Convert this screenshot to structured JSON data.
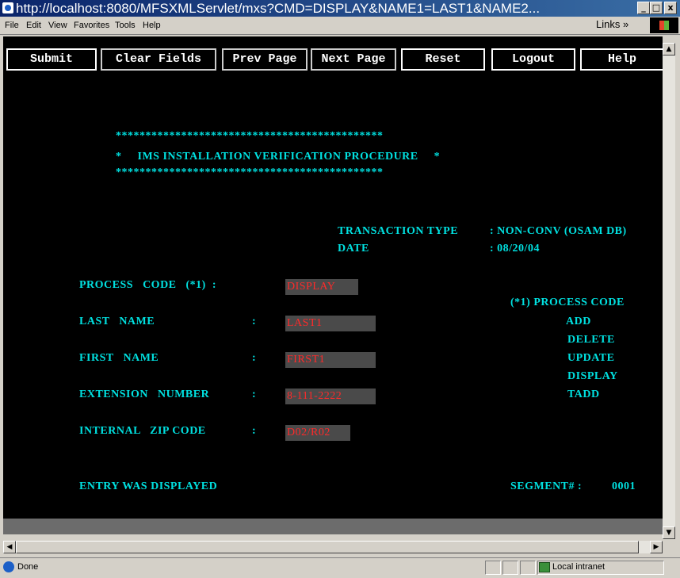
{
  "window": {
    "title": "http://localhost:8080/MFSXMLServlet/mxs?CMD=DISPLAY&NAME1=LAST1&NAME2...",
    "min": "_",
    "max": "□",
    "close": "x"
  },
  "menu": [
    "File",
    "Edit",
    "View",
    "Favorites",
    "Tools",
    "Help"
  ],
  "links_label": "Links »",
  "function_buttons": [
    "Submit",
    "Clear Fields",
    "Prev Page",
    "Next Page",
    "Reset",
    "Logout",
    "Help"
  ],
  "banner": {
    "border_top": "*********************************************",
    "title_line": "*     IMS INSTALLATION VERIFICATION PROCEDURE     *",
    "border_bottom": "*********************************************"
  },
  "transaction": {
    "type_label": "TRANSACTION TYPE",
    "type_value": ": NON-CONV (OSAM DB)",
    "date_label": "DATE",
    "date_value": ": 08/20/04"
  },
  "form": {
    "process_code_label": "PROCESS   CODE   (*1)  :",
    "process_code_value": "DISPLAY",
    "last_name_label": "LAST   NAME",
    "last_name_colon": ":",
    "last_name_value": "LAST1",
    "first_name_label": "FIRST   NAME",
    "first_name_colon": ":",
    "first_name_value": "FIRST1",
    "extension_label": "EXTENSION   NUMBER",
    "extension_colon": ":",
    "extension_value": "8-111-2222",
    "zip_label": "INTERNAL   ZIP CODE",
    "zip_colon": ":",
    "zip_value": "D02/R02"
  },
  "process_codes": {
    "header": "(*1) PROCESS CODE",
    "items": [
      "ADD",
      "DELETE",
      "UPDATE",
      "DISPLAY",
      "TADD"
    ]
  },
  "footer": {
    "message": "ENTRY WAS DISPLAYED",
    "segment_label": "SEGMENT# :",
    "segment_value": "0001"
  },
  "status": {
    "text": "Done",
    "zone": "Local intranet"
  }
}
